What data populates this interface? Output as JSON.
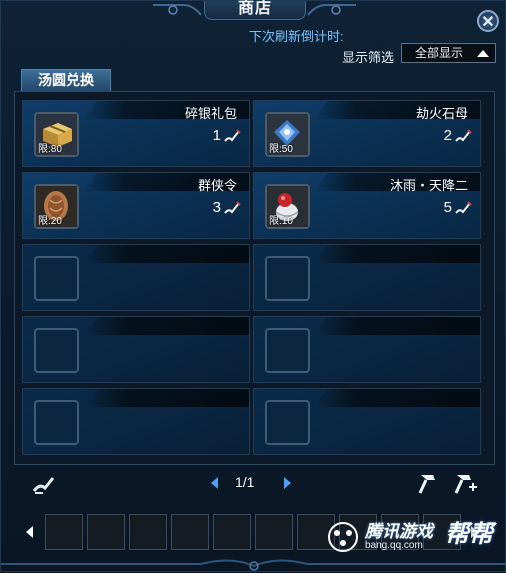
{
  "window": {
    "title": "商店"
  },
  "header": {
    "countdown_label": "下次刷新倒计时:",
    "filter_label": "显示筛选",
    "filter_value": "全部显示"
  },
  "tabs": [
    {
      "label": "汤圆兑换"
    }
  ],
  "items": [
    {
      "name": "碎银礼包",
      "quantity": "1",
      "limit": "限:80",
      "icon": "silver-pack-icon"
    },
    {
      "name": "劫火石母",
      "quantity": "2",
      "limit": "限:50",
      "icon": "fire-stone-icon"
    },
    {
      "name": "群侠令",
      "quantity": "3",
      "limit": "限:20",
      "icon": "hero-token-icon"
    },
    {
      "name": "沐雨・天降二",
      "quantity": "5",
      "limit": "限:10",
      "icon": "rain-item-icon"
    }
  ],
  "pager": {
    "text": "1/1"
  },
  "watermark": {
    "brand": "腾讯游戏",
    "big": "帮帮",
    "url": "bang.qq.com"
  },
  "colors": {
    "accent_blue": "#74c3ff",
    "slot_blue": "#0f3e6a",
    "pager_arrow": "#4aa0ff"
  }
}
